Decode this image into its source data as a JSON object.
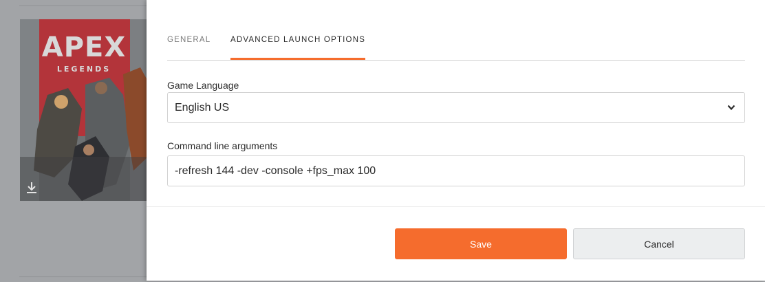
{
  "background": {
    "game_tile": {
      "logo_main": "APEX",
      "logo_sub": "LEGENDS",
      "download_icon": "download-icon"
    }
  },
  "modal": {
    "tabs": [
      {
        "label": "GENERAL",
        "active": false
      },
      {
        "label": "ADVANCED LAUNCH OPTIONS",
        "active": true
      }
    ],
    "game_language": {
      "label": "Game Language",
      "value": "English US",
      "icon": "chevron-down-icon"
    },
    "command_line": {
      "label": "Command line arguments",
      "value": "-refresh 144 -dev -console +fps_max 100"
    },
    "buttons": {
      "save_label": "Save",
      "cancel_label": "Cancel"
    }
  },
  "colors": {
    "accent": "#f56c2d",
    "overlay": "#a2a4a7",
    "cancel_bg": "#eceeef"
  }
}
